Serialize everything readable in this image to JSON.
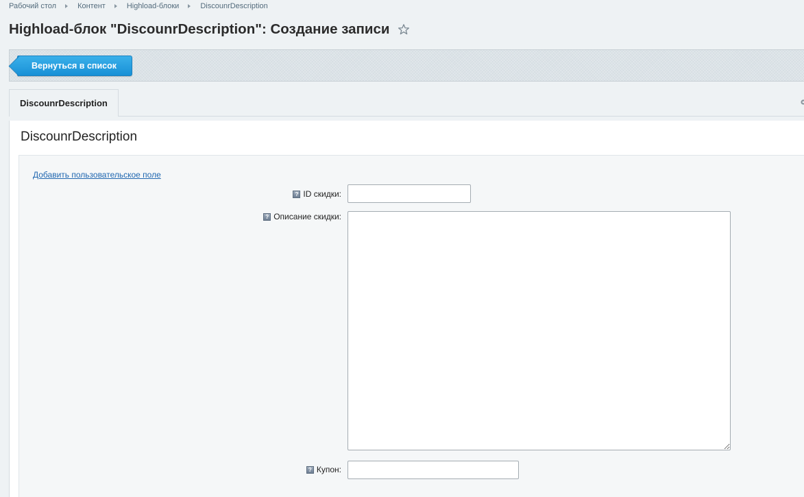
{
  "breadcrumbs": [
    {
      "label": "Рабочий стол"
    },
    {
      "label": "Контент"
    },
    {
      "label": "Highload-блоки"
    },
    {
      "label": "DiscounrDescription"
    }
  ],
  "page": {
    "title": "Highload-блок \"DiscounrDescription\": Создание записи",
    "favorite_icon": "star-outline-icon"
  },
  "toolbar": {
    "back_label": "Вернуться в список"
  },
  "tabs": [
    {
      "label": "DiscounrDescription",
      "active": true
    }
  ],
  "form": {
    "section_title": "DiscounrDescription",
    "add_field_link": "Добавить пользовательское поле",
    "fields": [
      {
        "label": "ID скидки:",
        "value": "",
        "type": "text"
      },
      {
        "label": "Описание скидки:",
        "value": "",
        "type": "textarea"
      },
      {
        "label": "Купон:",
        "value": "",
        "type": "text"
      }
    ],
    "help_icon_glyph": "?"
  },
  "colors": {
    "accent_button": "#1890d6",
    "link": "#2067b0",
    "background": "#eef2f4"
  }
}
